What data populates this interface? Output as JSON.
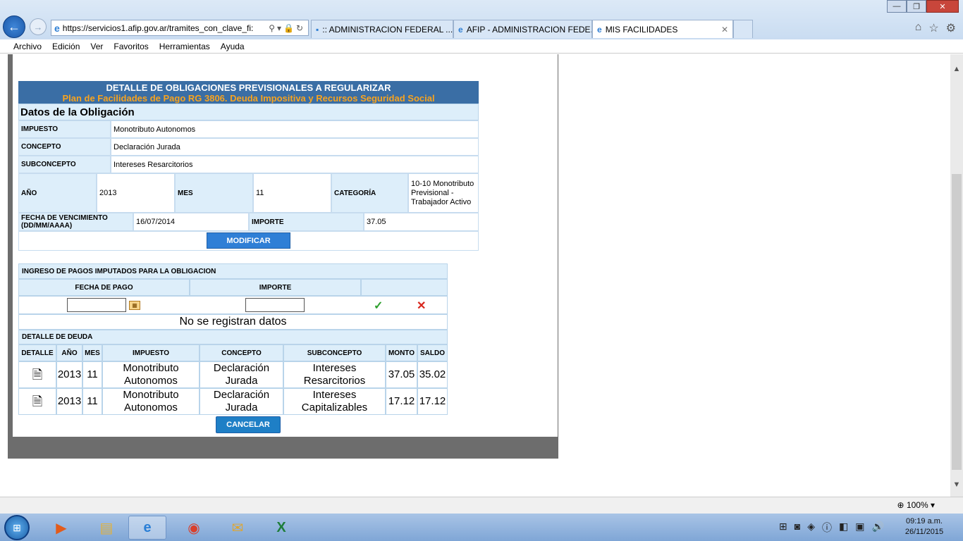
{
  "browser": {
    "url": "https://servicios1.afip.gov.ar/tramites_con_clave_fi:",
    "tabs": [
      {
        "label": ":: ADMINISTRACION FEDERAL ..."
      },
      {
        "label": "AFIP - ADMINISTRACION FEDE..."
      },
      {
        "label": "MIS FACILIDADES"
      }
    ],
    "menu": [
      "Archivo",
      "Edición",
      "Ver",
      "Favoritos",
      "Herramientas",
      "Ayuda"
    ],
    "zoom": "100%"
  },
  "page": {
    "title": "DETALLE DE OBLIGACIONES PREVISIONALES A REGULARIZAR",
    "subtitle": "Plan de Facilidades de Pago RG 3806. Deuda Impositiva y Recursos Seguridad Social",
    "datos_heading": "Datos de la Obligación",
    "impuesto_label": "IMPUESTO",
    "impuesto_value": "Monotributo Autonomos",
    "concepto_label": "CONCEPTO",
    "concepto_value": "Declaración Jurada",
    "subconcepto_label": "SUBCONCEPTO",
    "subconcepto_value": "Intereses Resarcitorios",
    "anio_label": "AÑO",
    "anio_value": "2013",
    "mes_label": "MES",
    "mes_value": "11",
    "categoria_label": "CATEGORÍA",
    "categoria_value": "10-10 Monotributo Previsional - Trabajador Activo",
    "vencimiento_label": "FECHA DE VENCIMIENTO (DD/MM/AAAA)",
    "vencimiento_value": "16/07/2014",
    "importe_label": "IMPORTE",
    "importe_value": "37.05",
    "modificar_button": "MODIFICAR",
    "ingreso_heading": "INGRESO DE PAGOS IMPUTADOS PARA LA OBLIGACION",
    "fecha_pago_header": "FECHA DE PAGO",
    "importe_header": "IMPORTE",
    "no_data": "No se registran datos",
    "detalle_heading": "DETALLE DE DEUDA",
    "deuda_headers": [
      "DETALLE",
      "AÑO",
      "MES",
      "IMPUESTO",
      "CONCEPTO",
      "SUBCONCEPTO",
      "MONTO",
      "SALDO"
    ],
    "deuda_rows": [
      {
        "anio": "2013",
        "mes": "11",
        "impuesto": "Monotributo Autonomos",
        "concepto": "Declaración Jurada",
        "subconcepto": "Intereses Resarcitorios",
        "monto": "37.05",
        "saldo": "35.02"
      },
      {
        "anio": "2013",
        "mes": "11",
        "impuesto": "Monotributo Autonomos",
        "concepto": "Declaración Jurada",
        "subconcepto": "Intereses Capitalizables",
        "monto": "17.12",
        "saldo": "17.12"
      }
    ],
    "cancelar_button": "CANCELAR"
  },
  "taskbar": {
    "time": "09:19 a.m.",
    "date": "26/11/2015"
  }
}
